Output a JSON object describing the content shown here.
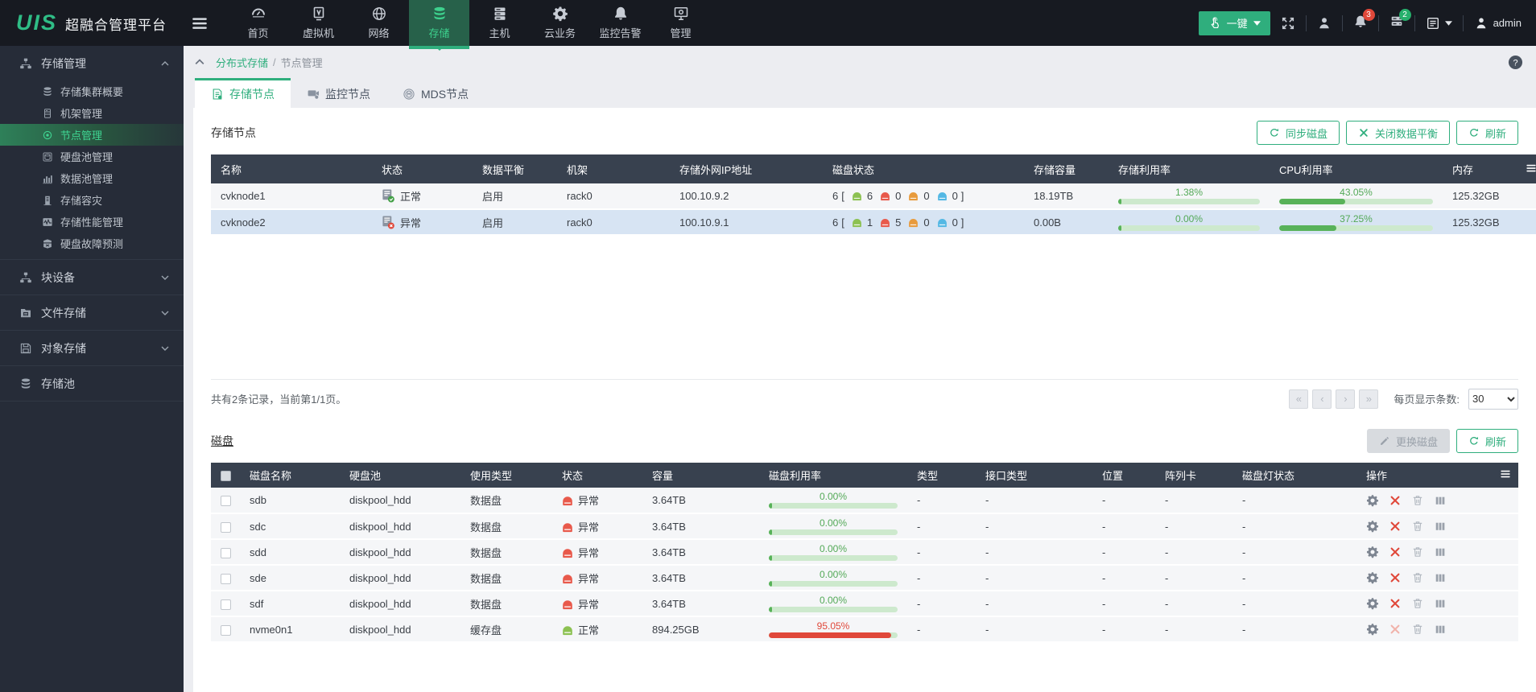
{
  "app": {
    "logo": "UIS",
    "title": "超融合管理平台"
  },
  "navbar": {
    "items": [
      {
        "label": "首页",
        "icon": "dashboard-icon",
        "active": false
      },
      {
        "label": "虚拟机",
        "icon": "vm-icon",
        "active": false
      },
      {
        "label": "网络",
        "icon": "globe-icon",
        "active": false
      },
      {
        "label": "存储",
        "icon": "database-icon",
        "active": true
      },
      {
        "label": "主机",
        "icon": "host-icon",
        "active": false
      },
      {
        "label": "云业务",
        "icon": "gear-icon",
        "active": false
      },
      {
        "label": "监控告警",
        "icon": "bell-icon",
        "active": false
      },
      {
        "label": "管理",
        "icon": "management-icon",
        "active": false
      }
    ],
    "quick_button_label": "一键",
    "alarm_badge": "3",
    "task_badge": "2",
    "user": "admin"
  },
  "sidebar": {
    "groups": [
      {
        "label": "存储管理",
        "icon": "sitemap-icon",
        "expanded": true,
        "items": [
          {
            "label": "存储集群概要",
            "icon": "database-icon",
            "active": false
          },
          {
            "label": "机架管理",
            "icon": "rack-icon",
            "active": false
          },
          {
            "label": "节点管理",
            "icon": "circle-dot-icon",
            "active": true
          },
          {
            "label": "硬盘池管理",
            "icon": "diskpool-icon",
            "active": false
          },
          {
            "label": "数据池管理",
            "icon": "barchart-icon",
            "active": false
          },
          {
            "label": "存储容灾",
            "icon": "building-icon",
            "active": false
          },
          {
            "label": "存储性能管理",
            "icon": "wave-icon",
            "active": false
          },
          {
            "label": "硬盘故障预测",
            "icon": "predict-icon",
            "active": false
          }
        ]
      },
      {
        "label": "块设备",
        "icon": "sitemap-icon",
        "expanded": false,
        "items": []
      },
      {
        "label": "文件存储",
        "icon": "folder-icon",
        "expanded": false,
        "items": []
      },
      {
        "label": "对象存储",
        "icon": "floppy-icon",
        "expanded": false,
        "items": []
      },
      {
        "label": "存储池",
        "icon": "database-icon",
        "expanded": null,
        "items": []
      }
    ]
  },
  "breadcrumb": {
    "parent": "分布式存储",
    "sep": "/",
    "current": "节点管理"
  },
  "tabs": [
    {
      "label": "存储节点",
      "icon": "storage-node-icon",
      "active": true
    },
    {
      "label": "监控节点",
      "icon": "monitor-node-icon",
      "active": false
    },
    {
      "label": "MDS节点",
      "icon": "mds-node-icon",
      "active": false
    }
  ],
  "nodes_section": {
    "title": "存储节点",
    "buttons": [
      {
        "label": "同步磁盘",
        "icon": "sync-icon",
        "disabled": false
      },
      {
        "label": "关闭数据平衡",
        "icon": "tools-icon",
        "disabled": false
      },
      {
        "label": "刷新",
        "icon": "refresh-icon",
        "disabled": false
      }
    ],
    "columns": [
      "名称",
      "状态",
      "数据平衡",
      "机架",
      "存储外网IP地址",
      "磁盘状态",
      "存储容量",
      "存储利用率",
      "CPU利用率",
      "内存"
    ],
    "rows": [
      {
        "name": "cvknode1",
        "status": "正常",
        "status_type": "ok",
        "balance": "启用",
        "rack": "rack0",
        "ip": "100.10.9.2",
        "disk_total": "6",
        "disk_green": "6",
        "disk_red": "0",
        "disk_orange": "0",
        "disk_blue": "0",
        "capacity": "18.19TB",
        "storage_util_label": "1.38%",
        "storage_util": 1.38,
        "cpu_util_label": "43.05%",
        "cpu_util": 43.05,
        "memory": "125.32GB",
        "selected": false
      },
      {
        "name": "cvknode2",
        "status": "异常",
        "status_type": "error",
        "balance": "启用",
        "rack": "rack0",
        "ip": "100.10.9.1",
        "disk_total": "6",
        "disk_green": "1",
        "disk_red": "5",
        "disk_orange": "0",
        "disk_blue": "0",
        "capacity": "0.00B",
        "storage_util_label": "0.00%",
        "storage_util": 0,
        "cpu_util_label": "37.25%",
        "cpu_util": 37.25,
        "memory": "125.32GB",
        "selected": true
      }
    ],
    "pagination": {
      "summary": "共有2条记录，当前第1/1页。",
      "nav": [
        "«",
        "‹",
        "›",
        "»"
      ],
      "page_size_label": "每页显示条数:",
      "page_size": "30"
    }
  },
  "disks_section": {
    "title": "磁盘",
    "buttons": [
      {
        "label": "更换磁盘",
        "icon": "pencil-icon",
        "disabled": true
      },
      {
        "label": "刷新",
        "icon": "refresh-icon",
        "disabled": false
      }
    ],
    "columns": [
      "磁盘名称",
      "硬盘池",
      "使用类型",
      "状态",
      "容量",
      "磁盘利用率",
      "类型",
      "接口类型",
      "位置",
      "阵列卡",
      "磁盘灯状态",
      "操作"
    ],
    "rows": [
      {
        "name": "sdb",
        "pool": "diskpool_hdd",
        "usage": "数据盘",
        "status": "异常",
        "status_type": "error",
        "capacity": "3.64TB",
        "util_label": "0.00%",
        "util": 0,
        "util_color": "green",
        "type": "-",
        "interface": "-",
        "position": "-",
        "raid_card": "-",
        "led": "-",
        "remove_disabled": false
      },
      {
        "name": "sdc",
        "pool": "diskpool_hdd",
        "usage": "数据盘",
        "status": "异常",
        "status_type": "error",
        "capacity": "3.64TB",
        "util_label": "0.00%",
        "util": 0,
        "util_color": "green",
        "type": "-",
        "interface": "-",
        "position": "-",
        "raid_card": "-",
        "led": "-",
        "remove_disabled": false
      },
      {
        "name": "sdd",
        "pool": "diskpool_hdd",
        "usage": "数据盘",
        "status": "异常",
        "status_type": "error",
        "capacity": "3.64TB",
        "util_label": "0.00%",
        "util": 0,
        "util_color": "green",
        "type": "-",
        "interface": "-",
        "position": "-",
        "raid_card": "-",
        "led": "-",
        "remove_disabled": false
      },
      {
        "name": "sde",
        "pool": "diskpool_hdd",
        "usage": "数据盘",
        "status": "异常",
        "status_type": "error",
        "capacity": "3.64TB",
        "util_label": "0.00%",
        "util": 0,
        "util_color": "green",
        "type": "-",
        "interface": "-",
        "position": "-",
        "raid_card": "-",
        "led": "-",
        "remove_disabled": false
      },
      {
        "name": "sdf",
        "pool": "diskpool_hdd",
        "usage": "数据盘",
        "status": "异常",
        "status_type": "error",
        "capacity": "3.64TB",
        "util_label": "0.00%",
        "util": 0,
        "util_color": "green",
        "type": "-",
        "interface": "-",
        "position": "-",
        "raid_card": "-",
        "led": "-",
        "remove_disabled": false
      },
      {
        "name": "nvme0n1",
        "pool": "diskpool_hdd",
        "usage": "缓存盘",
        "status": "正常",
        "status_type": "ok",
        "capacity": "894.25GB",
        "util_label": "95.05%",
        "util": 95.05,
        "util_color": "red",
        "type": "-",
        "interface": "-",
        "position": "-",
        "raid_card": "-",
        "led": "-",
        "remove_disabled": true
      }
    ]
  },
  "colors": {
    "accent": "#2fae7d",
    "error": "#e0483a",
    "ok": "#43a047",
    "disk_green": "#8cc152",
    "disk_red": "#e8594b",
    "disk_orange": "#e89b3d",
    "disk_blue": "#54b8e4",
    "selected_row": "#d7e4f3",
    "table_header": "#38414f"
  }
}
